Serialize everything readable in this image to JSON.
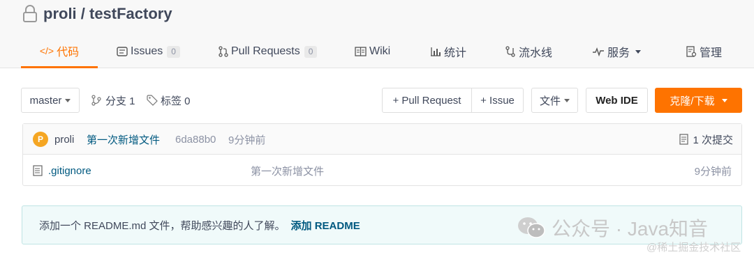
{
  "repo": {
    "title": "proli / testFactory"
  },
  "tabs": [
    {
      "label": "代码",
      "icon": "code-icon"
    },
    {
      "label": "Issues",
      "icon": "issues-icon",
      "count": "0"
    },
    {
      "label": "Pull Requests",
      "icon": "pull-request-icon",
      "count": "0"
    },
    {
      "label": "Wiki",
      "icon": "wiki-icon"
    },
    {
      "label": "统计",
      "icon": "chart-icon"
    },
    {
      "label": "流水线",
      "icon": "pipeline-icon"
    },
    {
      "label": "服务",
      "icon": "pulse-icon"
    },
    {
      "label": "管理",
      "icon": "settings-doc-icon"
    }
  ],
  "toolbar": {
    "branch": "master",
    "branches_label": "分支 1",
    "tags_label": "标签 0",
    "pull_request_label": "+ Pull Request",
    "issue_label": "+ Issue",
    "file_label": "文件",
    "webide_label": "Web IDE",
    "clone_label": "克隆/下载"
  },
  "commit": {
    "avatar_letter": "P",
    "author": "proli",
    "message": "第一次新增文件",
    "hash": "6da88b0",
    "time": "9分钟前",
    "count_label": "1 次提交"
  },
  "files": [
    {
      "name": ".gitignore",
      "message": "第一次新增文件",
      "time": "9分钟前"
    }
  ],
  "readme_notice": {
    "text": "添加一个 README.md 文件，帮助感兴趣的人了解。",
    "link": "添加 README"
  },
  "watermark": {
    "main": "公众号 · Java知音",
    "sub": "@稀土掘金技术社区"
  },
  "colors": {
    "accent": "#fe7300",
    "link": "#005980",
    "notice_bg": "#f0fafa"
  }
}
